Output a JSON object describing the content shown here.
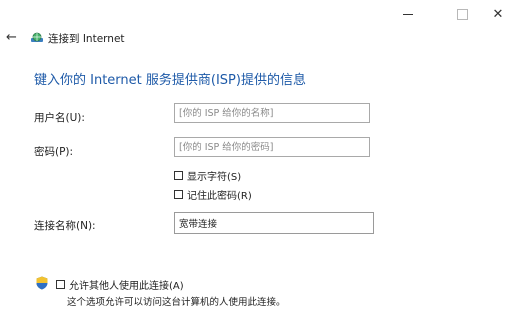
{
  "window": {
    "minimize_glyph": "",
    "close_glyph": "✕"
  },
  "header": {
    "back_glyph": "←",
    "title": "连接到 Internet",
    "icon": "network-globe-icon"
  },
  "main": {
    "heading": "键入你的 Internet 服务提供商(ISP)提供的信息",
    "username": {
      "label": "用户名(U):",
      "placeholder": "[你的 ISP 给你的名称]",
      "value": ""
    },
    "password": {
      "label": "密码(P):",
      "placeholder": "[你的 ISP 给你的密码]",
      "value": ""
    },
    "show_chars": {
      "label": "显示字符(S)",
      "checked": false
    },
    "remember": {
      "label": "记住此密码(R)",
      "checked": false
    },
    "connection_name": {
      "label": "连接名称(N):",
      "value": "宽带连接"
    },
    "allow_others": {
      "label": "允许其他人使用此连接(A)",
      "checked": false,
      "icon": "uac-shield-icon"
    },
    "allow_note": "这个选项允许可以访问这台计算机的人使用此连接。"
  },
  "colors": {
    "heading": "#1e5aa8",
    "field_border": "#a9a9a9"
  }
}
